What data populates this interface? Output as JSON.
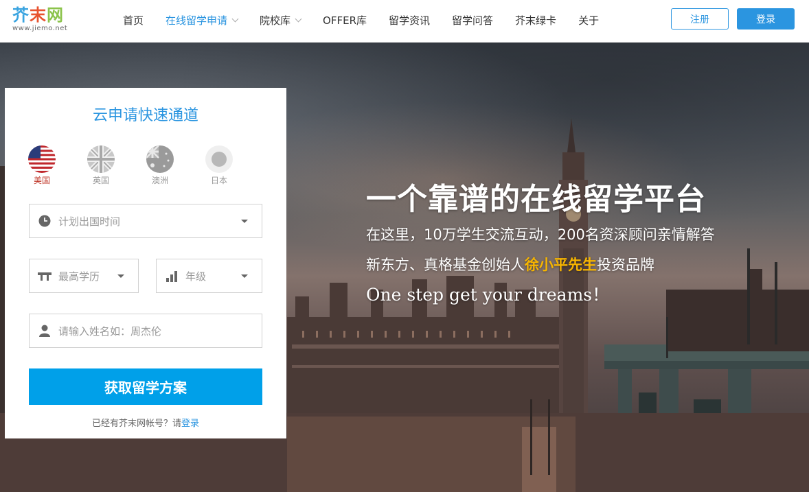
{
  "header": {
    "logo_text": "芥末网",
    "logo_url_text": "www.jiemo.net",
    "nav": [
      {
        "label": "首页",
        "active": false,
        "dropdown": false
      },
      {
        "label": "在线留学申请",
        "active": true,
        "dropdown": true
      },
      {
        "label": "院校库",
        "active": false,
        "dropdown": true
      },
      {
        "label": "OFFER库",
        "active": false,
        "dropdown": false
      },
      {
        "label": "留学资讯",
        "active": false,
        "dropdown": false
      },
      {
        "label": "留学问答",
        "active": false,
        "dropdown": false
      },
      {
        "label": "芥末绿卡",
        "active": false,
        "dropdown": false
      },
      {
        "label": "关于",
        "active": false,
        "dropdown": false
      }
    ],
    "register_label": "注册",
    "login_label": "登录"
  },
  "form": {
    "title": "云申请快速通道",
    "flags": [
      {
        "label": "美国",
        "active": true,
        "icon": "us-flag-icon"
      },
      {
        "label": "英国",
        "active": false,
        "icon": "uk-flag-icon"
      },
      {
        "label": "澳洲",
        "active": false,
        "icon": "au-flag-icon"
      },
      {
        "label": "日本",
        "active": false,
        "icon": "jp-flag-icon"
      }
    ],
    "departure_time_placeholder": "计划出国时间",
    "education_placeholder": "最高学历",
    "grade_placeholder": "年级",
    "name_placeholder": "请输入姓名如：周杰伦",
    "submit_label": "获取留学方案",
    "login_hint_prefix": "已经有芥末网帐号？请",
    "login_hint_link": "登录"
  },
  "hero": {
    "title": "一个靠谱的在线留学平台",
    "line1": "在这里，10万学生交流互动，200名资深顾问亲情解答",
    "line2_prefix": "新东方、真格基金创始人",
    "line2_highlight": "徐小平先生",
    "line2_suffix": "投资品牌",
    "english": "One step get your dreams！"
  },
  "colors": {
    "accent": "#2b95e0",
    "submit": "#00a0e9",
    "highlight": "#f7b500"
  }
}
